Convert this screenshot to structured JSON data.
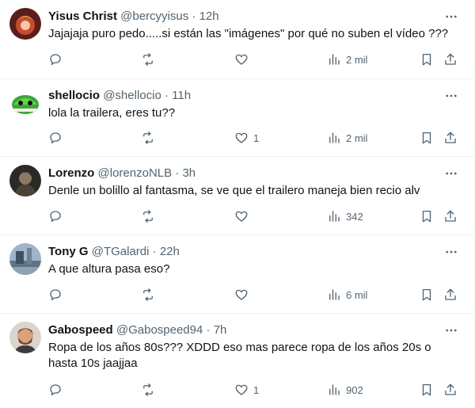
{
  "posts": [
    {
      "name": "Yisus Christ",
      "handle": "@bercyyisus",
      "dot": "·",
      "time": "12h",
      "text": "Jajajaja puro pedo.....si están las \"imágenes\" por qué no suben el vídeo ???",
      "replies": "",
      "reposts": "",
      "likes": "",
      "views": "2 mil",
      "avatar_icon": "anime-avatar-icon"
    },
    {
      "name": "shellocio",
      "handle": "@shellocio",
      "dot": "·",
      "time": "11h",
      "text": "lola la trailera, eres tu??",
      "replies": "",
      "reposts": "",
      "likes": "1",
      "views": "2 mil",
      "avatar_icon": "green-shell-avatar-icon"
    },
    {
      "name": "Lorenzo",
      "handle": "@lorenzoNLB",
      "dot": "·",
      "time": "3h",
      "text": "Denle un bolillo al fantasma, se ve que el trailero maneja bien recio alv",
      "replies": "",
      "reposts": "",
      "likes": "",
      "views": "342",
      "avatar_icon": "dark-character-avatar-icon"
    },
    {
      "name": "Tony G",
      "handle": "@TGalardi",
      "dot": "·",
      "time": "22h",
      "text": "A que altura pasa eso?",
      "replies": "",
      "reposts": "",
      "likes": "",
      "views": "6 mil",
      "avatar_icon": "landscape-avatar-icon"
    },
    {
      "name": "Gabospeed",
      "handle": "@Gabospeed94",
      "dot": "·",
      "time": "7h",
      "text": "Ropa de los años 80s??? XDDD eso mas parece ropa de los años 20s o hasta 10s jaajjaa",
      "replies": "",
      "reposts": "",
      "likes": "1",
      "views": "902",
      "avatar_icon": "bearded-man-avatar-icon"
    }
  ],
  "colors": {
    "text_primary": "#0f1419",
    "text_secondary": "#536471",
    "divider": "#eff3f4"
  }
}
